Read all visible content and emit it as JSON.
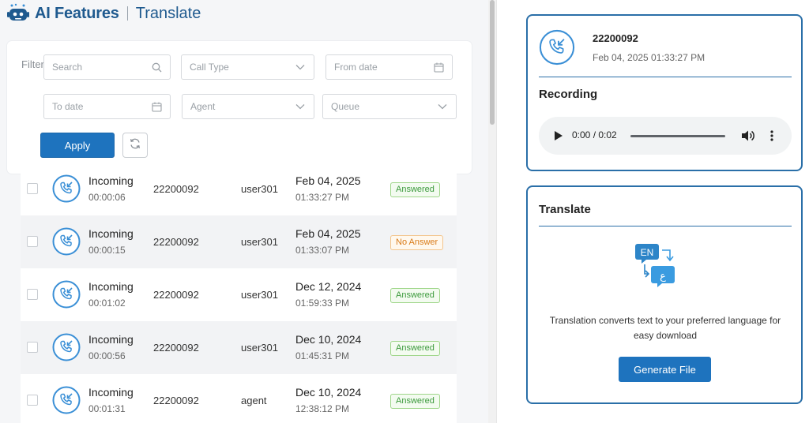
{
  "header": {
    "app_title": "AI Features",
    "page_title": "Translate"
  },
  "filters": {
    "label": "Filters",
    "search_placeholder": "Search",
    "call_type_placeholder": "Call Type",
    "from_date_placeholder": "From date",
    "to_date_placeholder": "To date",
    "agent_placeholder": "Agent",
    "queue_placeholder": "Queue",
    "apply_label": "Apply"
  },
  "calls": [
    {
      "direction": "Incoming",
      "duration": "00:00:06",
      "number": "22200092",
      "agent": "user301",
      "date": "Feb 04, 2025",
      "time": "01:33:27 PM",
      "status": "Answered"
    },
    {
      "direction": "Incoming",
      "duration": "00:00:15",
      "number": "22200092",
      "agent": "user301",
      "date": "Feb 04, 2025",
      "time": "01:33:07 PM",
      "status": "No Answer"
    },
    {
      "direction": "Incoming",
      "duration": "00:01:02",
      "number": "22200092",
      "agent": "user301",
      "date": "Dec 12, 2024",
      "time": "01:59:33 PM",
      "status": "Answered"
    },
    {
      "direction": "Incoming",
      "duration": "00:00:56",
      "number": "22200092",
      "agent": "user301",
      "date": "Dec 10, 2024",
      "time": "01:45:31 PM",
      "status": "Answered"
    },
    {
      "direction": "Incoming",
      "duration": "00:01:31",
      "number": "22200092",
      "agent": "agent",
      "date": "Dec 10, 2024",
      "time": "12:38:12 PM",
      "status": "Answered"
    }
  ],
  "recording": {
    "number": "22200092",
    "datetime": "Feb 04, 2025 01:33:27 PM",
    "title": "Recording",
    "player_time": "0:00 / 0:02"
  },
  "translate": {
    "title": "Translate",
    "art_label": "EN",
    "art_label_ar": "ع",
    "description": "Translation converts text to your preferred language for easy download",
    "button_label": "Generate File"
  },
  "colors": {
    "primary": "#1e73be",
    "card_border": "#2a6fa8",
    "icon_blue": "#3a8fd6",
    "answered": "#3c9a3c",
    "no_answer": "#d97a17"
  }
}
